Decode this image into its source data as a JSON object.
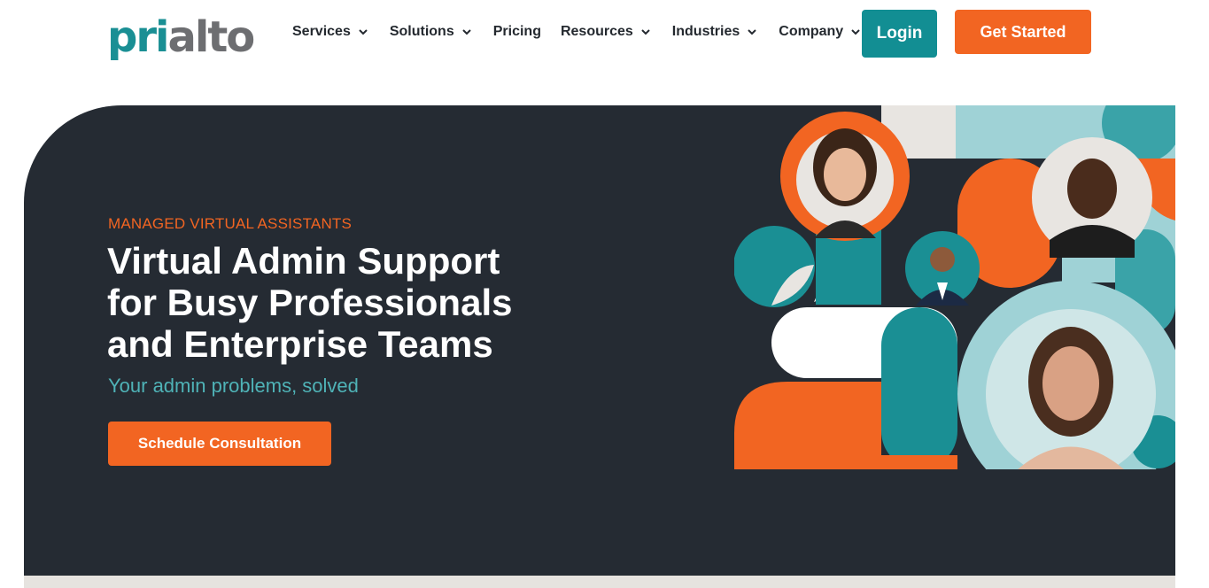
{
  "brand": {
    "logo_part1": "pri",
    "logo_part2": "alto"
  },
  "nav": {
    "items": [
      {
        "label": "Services",
        "has_dropdown": true
      },
      {
        "label": "Solutions",
        "has_dropdown": true
      },
      {
        "label": "Pricing",
        "has_dropdown": false
      },
      {
        "label": "Resources",
        "has_dropdown": true
      },
      {
        "label": "Industries",
        "has_dropdown": true
      },
      {
        "label": "Company",
        "has_dropdown": true
      }
    ],
    "login_label": "Login",
    "get_started_label": "Get Started"
  },
  "hero": {
    "eyebrow": "MANAGED VIRTUAL ASSISTANTS",
    "headline_line1": "Virtual Admin Support",
    "headline_line2": "for Busy Professionals",
    "headline_line3": "and Enterprise Teams",
    "subline": "Your admin problems, solved",
    "cta_label": "Schedule Consultation"
  },
  "colors": {
    "teal": "#128e93",
    "orange": "#f26522",
    "dark": "#252b33",
    "light_teal": "#9fd2d6",
    "cream": "#e8e5e1"
  },
  "icons": {
    "dropdown": "chevron-down-icon"
  }
}
